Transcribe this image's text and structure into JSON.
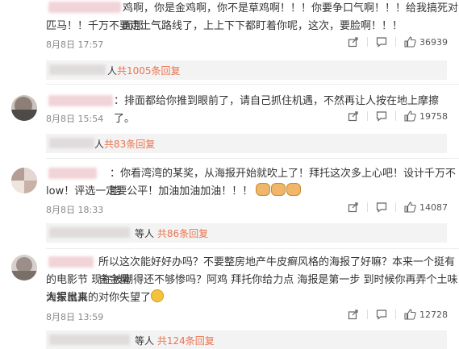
{
  "comments": [
    {
      "text_line1": "鸡啊，你是金鸡啊，你不是草鸡啊！！！你要争口气啊！！！给我搞死对面那",
      "text_line2": "匹马！！千万不要走土气路线了，上上下下都盯着你呢，这次，要脸啊！！！",
      "date": "8月8日 17:57",
      "likes": "36939",
      "replies_suffix": "人",
      "replies_count": "共1005条回复"
    },
    {
      "text_line1": "：排面都给你推到眼前了，请自己抓住机遇，不然再让人按在地上摩擦了。",
      "date": "8月8日 15:54",
      "likes": "19758",
      "replies_suffix": "人",
      "replies_count": "共83条回复"
    },
    {
      "text_line1": "：你看湾湾的某奖，从海报开始就吹上了！拜托这次多上心吧！设计千万不能",
      "text_line2": "low！评选一定要公平！加油加油加油！！！",
      "date": "8月8日 18:33",
      "likes": "14087",
      "replies_suffix": "等人",
      "replies_count": "共86条回复"
    },
    {
      "text_line1": "所以这次能好好办吗？不要整房地产牛皮癣风格的海报了好嘛？本来一个挺有含金量",
      "text_line2": "的电影节 现在被嘲得还不够惨吗？阿鸡 拜托你给力点 海报是第一步 到时候你再弄个土味海报出来",
      "text_line3": "大家就真的对你失望了",
      "date": "8月8日 13:59",
      "likes": "12728",
      "replies_suffix": "等人",
      "replies_count": "共124条回复"
    }
  ]
}
